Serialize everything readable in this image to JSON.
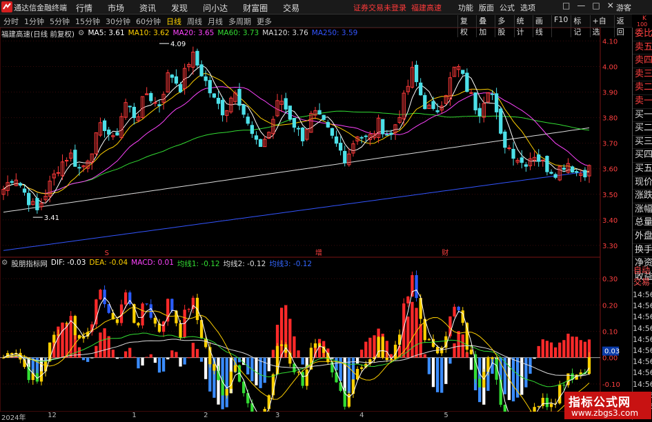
{
  "app": {
    "title": "通达信金融终端",
    "guest": "游客",
    "notice_left": "证券交易未登录",
    "notice_right": "福建高速"
  },
  "menu": [
    "行情",
    "市场",
    "资讯",
    "发现",
    "问小达",
    "财富圈",
    "交易"
  ],
  "right_menu": [
    "功能",
    "版面",
    "公式",
    "选项"
  ],
  "window_controls": [
    "□",
    "—",
    "□",
    "✕"
  ],
  "periods": {
    "items": [
      "分时",
      "1分钟",
      "5分钟",
      "15分钟",
      "30分钟",
      "60分钟",
      "日线",
      "周线",
      "月线",
      "多周期",
      "更多"
    ],
    "active": "日线"
  },
  "tools": [
    "复权",
    "叠加",
    "多股",
    "统计",
    "画线",
    "F10",
    "标记",
    "+自选",
    "返回"
  ],
  "top_right_marks": [
    "K",
    "100"
  ],
  "colors": {
    "up": "#ff3a3a",
    "down": "#4de0e8",
    "ma5": "#ffffff",
    "ma10": "#ffd000",
    "ma20": "#ff44ff",
    "ma60": "#33dd33",
    "ma120": "#dddddd",
    "ma250": "#3355ff",
    "dif": "#ffffff",
    "dea": "#ffd000",
    "jx1": "#33dd33",
    "jx2": "#dddddd",
    "jx3": "#3366ff"
  },
  "main_legend": {
    "stock": "福建高速(日线 前复权)",
    "items": [
      {
        "label": "MA5: 3.61",
        "color": "#ffffff"
      },
      {
        "label": "MA10: 3.62",
        "color": "#ffd000"
      },
      {
        "label": "MA20: 3.65",
        "color": "#ff44ff"
      },
      {
        "label": "MA60: 3.73",
        "color": "#33dd33"
      },
      {
        "label": "MA120: 3.76",
        "color": "#dddddd"
      },
      {
        "label": "MA250: 3.59",
        "color": "#3355ff"
      }
    ]
  },
  "sub_legend": {
    "name": "股朋指标网",
    "items": [
      {
        "label": "DIF: -0.03",
        "color": "#ffffff"
      },
      {
        "label": "DEA: -0.04",
        "color": "#ffd000"
      },
      {
        "label": "MACD: 0.01",
        "color": "#ff44ff"
      },
      {
        "label": "均线1: -0.12",
        "color": "#33dd33"
      },
      {
        "label": "均线2: -0.12",
        "color": "#dddddd"
      },
      {
        "label": "均线3: -0.12",
        "color": "#3366ff"
      }
    ]
  },
  "sidebar": [
    "委比",
    "卖五",
    "卖四",
    "卖三",
    "卖二",
    "卖一",
    "买一",
    "买二",
    "买三",
    "买四",
    "买五",
    "现价",
    "涨跌",
    "涨幅",
    "总量",
    "外盘",
    "换手",
    "净资",
    "收益"
  ],
  "side_ops": [
    "自动",
    "交易"
  ],
  "side_prices": [
    "14:56",
    "14:56",
    "14:56",
    "14:56",
    "14:56",
    "14:56",
    "14:56",
    "14:56",
    "14:56",
    "14:56",
    "14:56"
  ],
  "watermark": {
    "line1": "指标公式网",
    "line2": "www.zbgs3.com"
  },
  "chart_data": {
    "type": "candlestick",
    "price_axis": {
      "ticks": [
        "4.10",
        "4.00",
        "3.90",
        "3.80",
        "3.70",
        "3.60",
        "3.50",
        "3.40",
        "3.30"
      ],
      "range": [
        3.27,
        4.12
      ]
    },
    "sub_axis": {
      "ticks": [
        "0.30",
        "0.20",
        "0.10",
        "0.00",
        "-0.10"
      ],
      "range": [
        -0.2,
        0.35
      ]
    },
    "cursor_value": "0.03",
    "annotations": [
      {
        "text": "4.09",
        "index": 37,
        "value": 4.09
      },
      {
        "text": "3.41",
        "index": 7,
        "value": 3.41
      }
    ],
    "event_marks": [
      {
        "text": "S",
        "index": 24
      },
      {
        "text": "增",
        "index": 74
      },
      {
        "text": "财",
        "index": 104
      }
    ],
    "x_labels": [
      {
        "text": "2024年",
        "index": 0
      },
      {
        "text": "12",
        "index": 11
      },
      {
        "text": "1",
        "index": 31
      },
      {
        "text": "2",
        "index": 48
      },
      {
        "text": "3",
        "index": 65
      },
      {
        "text": "4",
        "index": 85
      },
      {
        "text": "5",
        "index": 105
      }
    ],
    "seed": [
      3.52,
      3.58,
      3.5,
      3.43,
      3.52,
      3.61,
      3.66,
      3.59,
      3.68,
      3.78,
      3.7,
      3.86,
      3.8,
      3.9,
      3.84,
      3.98,
      3.92,
      4.05,
      3.97,
      3.87,
      3.82,
      3.92,
      3.78,
      3.68,
      3.74,
      3.88,
      3.8,
      3.72,
      3.82,
      3.77,
      3.7,
      3.64,
      3.74,
      3.71,
      3.78,
      3.72,
      3.84,
      3.98,
      3.86,
      3.81,
      3.9,
      4.01,
      3.91,
      3.82,
      3.94,
      3.72,
      3.67,
      3.62,
      3.66,
      3.61,
      3.59,
      3.63,
      3.58,
      3.6
    ]
  }
}
